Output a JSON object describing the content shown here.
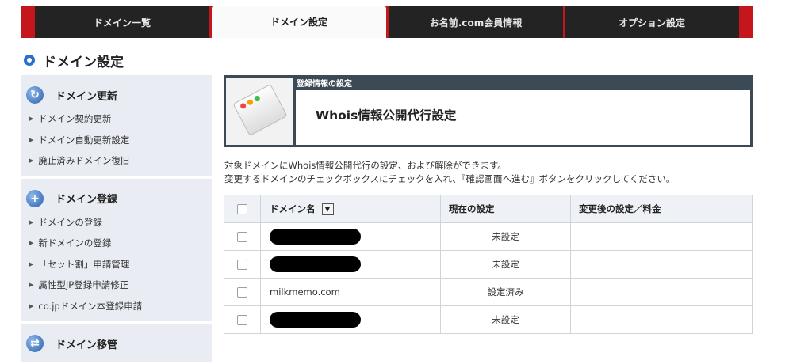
{
  "tabs": [
    {
      "label": "ドメイン一覧"
    },
    {
      "label": "ドメイン設定"
    },
    {
      "label": "お名前.com会員情報"
    },
    {
      "label": "オプション設定"
    }
  ],
  "page_title": "ドメイン設定",
  "sidebar": {
    "sections": [
      {
        "title": "ドメイン更新",
        "items": [
          "ドメイン契約更新",
          "ドメイン自動更新設定",
          "廃止済みドメイン復旧"
        ]
      },
      {
        "title": "ドメイン登録",
        "items": [
          "ドメインの登録",
          "新ドメインの登録",
          "「セット割」申請管理",
          "属性型JP登録申請修正",
          "co.jpドメイン本登録申請"
        ]
      },
      {
        "title": "ドメイン移管",
        "items": []
      }
    ]
  },
  "header": {
    "sub": "登録情報の設定",
    "title": "Whois情報公開代行設定"
  },
  "description": [
    "対象ドメインにWhois情報公開代行の設定、および解除ができます。",
    "変更するドメインのチェックボックスにチェックを入れ、『確認画面へ進む』ボタンをクリックしてください。"
  ],
  "table": {
    "headers": {
      "domain": "ドメイン名",
      "current": "現在の設定",
      "new": "変更後の設定／料金"
    },
    "rows": [
      {
        "domain": "",
        "current": "未設定",
        "new": ""
      },
      {
        "domain": "",
        "current": "未設定",
        "new": ""
      },
      {
        "domain": "milkmemo.com",
        "current": "設定済み",
        "new": ""
      },
      {
        "domain": "",
        "current": "未設定",
        "new": ""
      }
    ]
  },
  "colors": {
    "accent_red": "#c4161c",
    "tab_dark": "#232323",
    "header_dark": "#3c4a55",
    "blue": "#2a6fc9"
  }
}
